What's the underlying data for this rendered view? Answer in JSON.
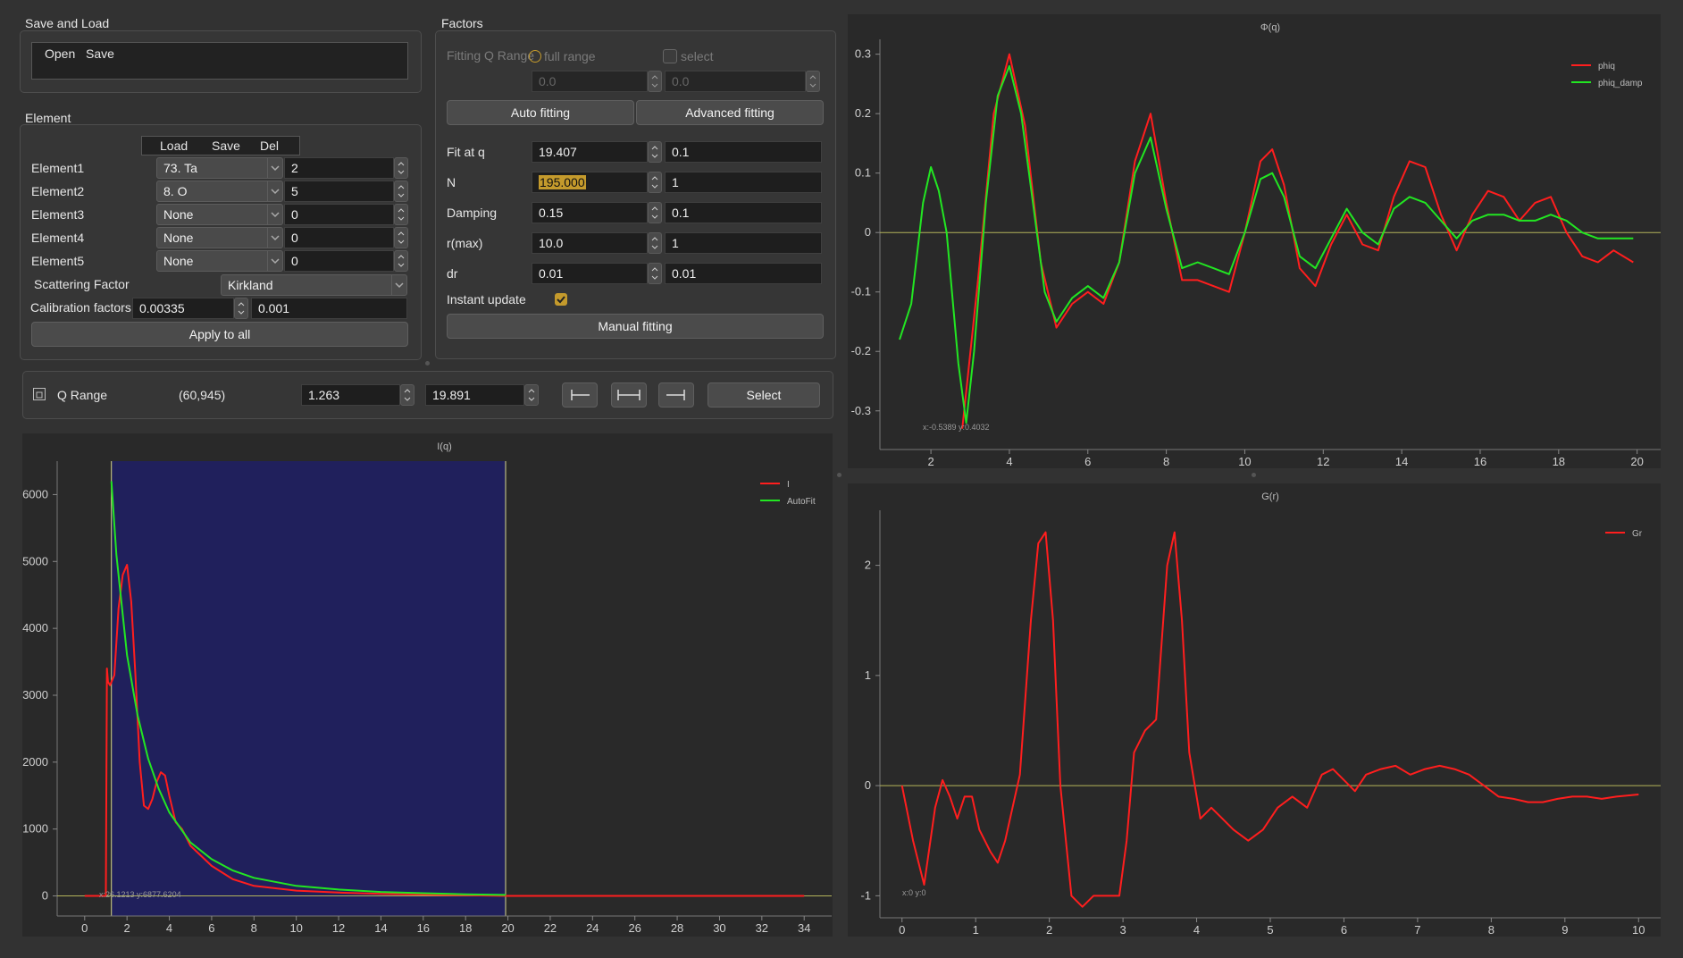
{
  "save_load": {
    "title": "Save and Load",
    "open": "Open",
    "save": "Save"
  },
  "element": {
    "title": "Element",
    "buttons": {
      "load": "Load",
      "save": "Save",
      "del": "Del"
    },
    "rows": [
      {
        "label": "Element1",
        "element": "73. Ta",
        "count": "2"
      },
      {
        "label": "Element2",
        "element": "8. O",
        "count": "5"
      },
      {
        "label": "Element3",
        "element": "None",
        "count": "0"
      },
      {
        "label": "Element4",
        "element": "None",
        "count": "0"
      },
      {
        "label": "Element5",
        "element": "None",
        "count": "0"
      }
    ],
    "scattering_label": "Scattering Factor",
    "scattering_value": "Kirkland",
    "calibration_label": "Calibration factors",
    "calibration_value": "0.00335",
    "calibration_step": "0.001",
    "apply_all": "Apply to all"
  },
  "factors": {
    "title": "Factors",
    "fitting_q_range": "Fitting Q Range",
    "full_range": "full range",
    "select": "select",
    "range_min": "0.0",
    "range_max": "0.0",
    "auto_fitting": "Auto fitting",
    "advanced_fitting": "Advanced fitting",
    "rows": [
      {
        "label": "Fit at q",
        "value": "19.407",
        "step": "0.1"
      },
      {
        "label": "N",
        "value": "195.000",
        "step": "1"
      },
      {
        "label": "Damping",
        "value": "0.15",
        "step": "0.1"
      },
      {
        "label": "r(max)",
        "value": "10.0",
        "step": "1"
      },
      {
        "label": "dr",
        "value": "0.01",
        "step": "0.01"
      }
    ],
    "instant_update": "Instant update",
    "manual_fitting": "Manual fitting"
  },
  "q_range": {
    "label": "Q Range",
    "indices": "(60,945)",
    "min": "1.263",
    "max": "19.891",
    "select": "Select"
  },
  "colors": {
    "red": "#ff1e1e",
    "green": "#22e622",
    "bg": "#292929",
    "region": "#20205c",
    "zero": "#b4b45a"
  },
  "chart_data": [
    {
      "type": "line",
      "title": "I(q)",
      "xlim": [
        -1.3,
        35.3
      ],
      "ylim": [
        -300,
        6500
      ],
      "xticks": [
        "0",
        "2",
        "4",
        "6",
        "8",
        "10",
        "12",
        "14",
        "16",
        "18",
        "20",
        "22",
        "24",
        "26",
        "28",
        "30",
        "32",
        "34"
      ],
      "yticks": [
        "0",
        "1000",
        "2000",
        "3000",
        "4000",
        "5000",
        "6000"
      ],
      "legend": [
        "I",
        "AutoFit"
      ],
      "cursor": "x:26.1213 y:6877.6204",
      "series": [
        {
          "name": "I",
          "x": [
            0,
            1,
            1.05,
            1.1,
            1.2,
            1.4,
            1.6,
            1.8,
            2.0,
            2.2,
            2.4,
            2.6,
            2.8,
            3.0,
            3.2,
            3.4,
            3.6,
            3.8,
            4.0,
            4.3,
            4.6,
            5,
            6,
            7,
            8,
            10,
            12,
            14,
            16,
            18,
            20,
            34
          ],
          "y": [
            0,
            0,
            3400,
            3200,
            3150,
            3300,
            4300,
            4800,
            4950,
            4400,
            3300,
            2000,
            1350,
            1300,
            1450,
            1700,
            1850,
            1800,
            1500,
            1100,
            1000,
            750,
            450,
            250,
            150,
            80,
            50,
            30,
            20,
            10,
            0,
            0
          ]
        },
        {
          "name": "AutoFit",
          "x": [
            1.263,
            1.5,
            2,
            2.5,
            3,
            3.5,
            4,
            5,
            6,
            7,
            8,
            10,
            12,
            14,
            16,
            18,
            19.9
          ],
          "y": [
            6200,
            5100,
            3600,
            2700,
            2050,
            1600,
            1250,
            800,
            550,
            380,
            270,
            150,
            95,
            60,
            40,
            25,
            15
          ]
        }
      ]
    },
    {
      "type": "line",
      "title": "Φ(q)",
      "xlim": [
        0.7,
        20.6
      ],
      "ylim": [
        -0.365,
        0.325
      ],
      "xticks": [
        "2",
        "4",
        "6",
        "8",
        "10",
        "12",
        "14",
        "16",
        "18",
        "20"
      ],
      "yticks": [
        "-0.3",
        "-0.2",
        "-0.1",
        "0",
        "0.1",
        "0.2",
        "0.3"
      ],
      "legend": [
        "phiq",
        "phiq_damp"
      ],
      "cursor": "x:-0.5389 y:0.4032",
      "series": [
        {
          "name": "phiq",
          "x": [
            2.8,
            3.2,
            3.6,
            4,
            4.4,
            4.8,
            5.2,
            5.6,
            6,
            6.4,
            6.8,
            7.2,
            7.6,
            8,
            8.4,
            8.8,
            9.2,
            9.6,
            10,
            10.4,
            10.7,
            11,
            11.4,
            11.8,
            12.2,
            12.6,
            13,
            13.4,
            13.8,
            14.2,
            14.6,
            15,
            15.4,
            15.8,
            16.2,
            16.6,
            17,
            17.4,
            17.8,
            18.2,
            18.6,
            19,
            19.4,
            19.9
          ],
          "y": [
            -0.33,
            -0.08,
            0.2,
            0.3,
            0.18,
            -0.05,
            -0.16,
            -0.12,
            -0.1,
            -0.12,
            -0.05,
            0.12,
            0.2,
            0.05,
            -0.08,
            -0.08,
            -0.09,
            -0.1,
            0.0,
            0.12,
            0.14,
            0.08,
            -0.06,
            -0.09,
            -0.02,
            0.03,
            -0.02,
            -0.03,
            0.06,
            0.12,
            0.11,
            0.03,
            -0.03,
            0.03,
            0.07,
            0.06,
            0.02,
            0.05,
            0.06,
            0.0,
            -0.04,
            -0.05,
            -0.03,
            -0.05
          ]
        },
        {
          "name": "phiq_damp",
          "x": [
            1.2,
            1.5,
            1.8,
            2,
            2.2,
            2.4,
            2.7,
            2.9,
            3.1,
            3.4,
            3.7,
            4,
            4.3,
            4.6,
            4.9,
            5.2,
            5.6,
            6,
            6.4,
            6.8,
            7.2,
            7.6,
            8,
            8.4,
            8.8,
            9.2,
            9.6,
            10,
            10.4,
            10.7,
            11,
            11.4,
            11.8,
            12.2,
            12.6,
            13,
            13.4,
            13.8,
            14.2,
            14.6,
            15,
            15.4,
            15.8,
            16.2,
            16.6,
            17,
            17.4,
            17.8,
            18.2,
            18.6,
            19,
            19.4,
            19.9
          ],
          "y": [
            -0.18,
            -0.12,
            0.05,
            0.11,
            0.07,
            0.0,
            -0.22,
            -0.32,
            -0.2,
            0.05,
            0.23,
            0.28,
            0.2,
            0.05,
            -0.1,
            -0.15,
            -0.11,
            -0.09,
            -0.11,
            -0.05,
            0.1,
            0.16,
            0.04,
            -0.06,
            -0.05,
            -0.06,
            -0.07,
            0.0,
            0.09,
            0.1,
            0.06,
            -0.04,
            -0.06,
            -0.01,
            0.04,
            0.0,
            -0.02,
            0.04,
            0.06,
            0.05,
            0.02,
            -0.01,
            0.02,
            0.03,
            0.03,
            0.02,
            0.02,
            0.03,
            0.02,
            0.0,
            -0.01,
            -0.01,
            -0.01
          ]
        }
      ]
    },
    {
      "type": "line",
      "title": "G(r)",
      "xlim": [
        -0.3,
        10.3
      ],
      "ylim": [
        -1.2,
        2.5
      ],
      "xticks": [
        "0",
        "1",
        "2",
        "3",
        "4",
        "5",
        "6",
        "7",
        "8",
        "9",
        "10"
      ],
      "yticks": [
        "-1",
        "0",
        "1",
        "2"
      ],
      "legend": [
        "Gr"
      ],
      "cursor": "x:0 y:0",
      "series": [
        {
          "name": "Gr",
          "x": [
            0,
            0.15,
            0.3,
            0.45,
            0.55,
            0.65,
            0.75,
            0.85,
            0.95,
            1.05,
            1.2,
            1.3,
            1.4,
            1.6,
            1.75,
            1.85,
            1.95,
            2.05,
            2.15,
            2.3,
            2.45,
            2.6,
            2.8,
            2.95,
            3.05,
            3.15,
            3.3,
            3.45,
            3.6,
            3.7,
            3.8,
            3.9,
            4.05,
            4.2,
            4.35,
            4.5,
            4.7,
            4.9,
            5.1,
            5.3,
            5.5,
            5.7,
            5.85,
            6.0,
            6.15,
            6.3,
            6.5,
            6.7,
            6.9,
            7.1,
            7.3,
            7.5,
            7.7,
            7.9,
            8.1,
            8.3,
            8.5,
            8.7,
            8.9,
            9.1,
            9.3,
            9.5,
            9.7,
            10
          ],
          "y": [
            0,
            -0.5,
            -0.9,
            -0.2,
            0.05,
            -0.1,
            -0.3,
            -0.1,
            -0.1,
            -0.4,
            -0.6,
            -0.7,
            -0.5,
            0.1,
            1.5,
            2.2,
            2.3,
            1.5,
            0,
            -1.0,
            -1.1,
            -1.0,
            -1.0,
            -1.0,
            -0.5,
            0.3,
            0.5,
            0.6,
            2.0,
            2.3,
            1.5,
            0.3,
            -0.3,
            -0.2,
            -0.3,
            -0.4,
            -0.5,
            -0.4,
            -0.2,
            -0.1,
            -0.2,
            0.1,
            0.15,
            0.05,
            -0.05,
            0.1,
            0.15,
            0.18,
            0.1,
            0.15,
            0.18,
            0.15,
            0.1,
            0.0,
            -0.1,
            -0.12,
            -0.15,
            -0.15,
            -0.12,
            -0.1,
            -0.1,
            -0.12,
            -0.1,
            -0.08
          ]
        }
      ]
    }
  ]
}
